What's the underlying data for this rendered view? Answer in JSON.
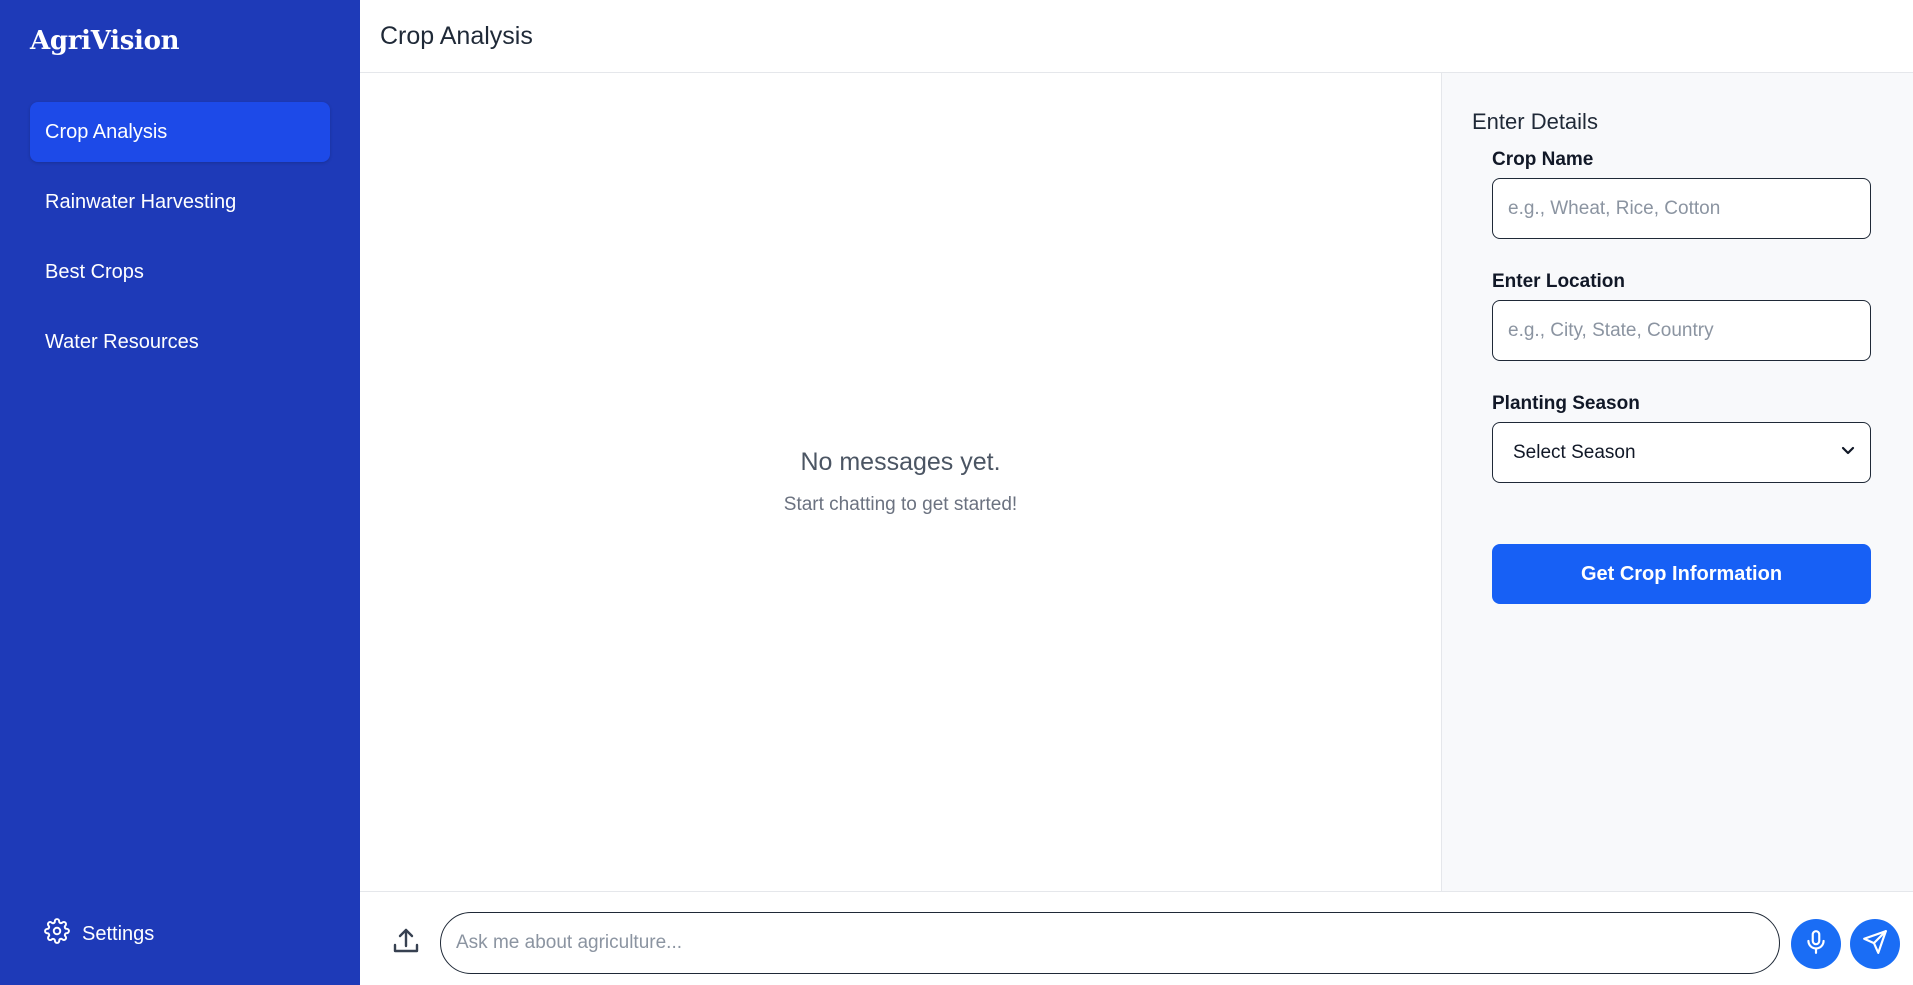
{
  "sidebar": {
    "brand": "AgriVision",
    "items": [
      {
        "label": "Crop Analysis",
        "active": true
      },
      {
        "label": "Rainwater Harvesting",
        "active": false
      },
      {
        "label": "Best Crops",
        "active": false
      },
      {
        "label": "Water Resources",
        "active": false
      }
    ],
    "settings_label": "Settings",
    "settings_icon": "gear-icon"
  },
  "header": {
    "title": "Crop Analysis"
  },
  "chat": {
    "empty_title": "No messages yet.",
    "empty_subtitle": "Start chatting to get started!"
  },
  "details": {
    "title": "Enter Details",
    "crop_name": {
      "label": "Crop Name",
      "placeholder": "e.g., Wheat, Rice, Cotton",
      "value": ""
    },
    "location": {
      "label": "Enter Location",
      "placeholder": "e.g., City, State, Country",
      "value": ""
    },
    "season": {
      "label": "Planting Season",
      "selected": "Select Season"
    },
    "submit_label": "Get Crop Information"
  },
  "composer": {
    "placeholder": "Ask me about agriculture...",
    "value": "",
    "upload_icon": "upload-icon",
    "mic_icon": "microphone-icon",
    "send_icon": "send-icon"
  },
  "colors": {
    "sidebar_bg": "#1e3ab8",
    "active_item": "#1d4ae8",
    "primary_button": "#1760f5",
    "round_button": "#1a6df5",
    "details_bg": "#f8f9fb"
  }
}
